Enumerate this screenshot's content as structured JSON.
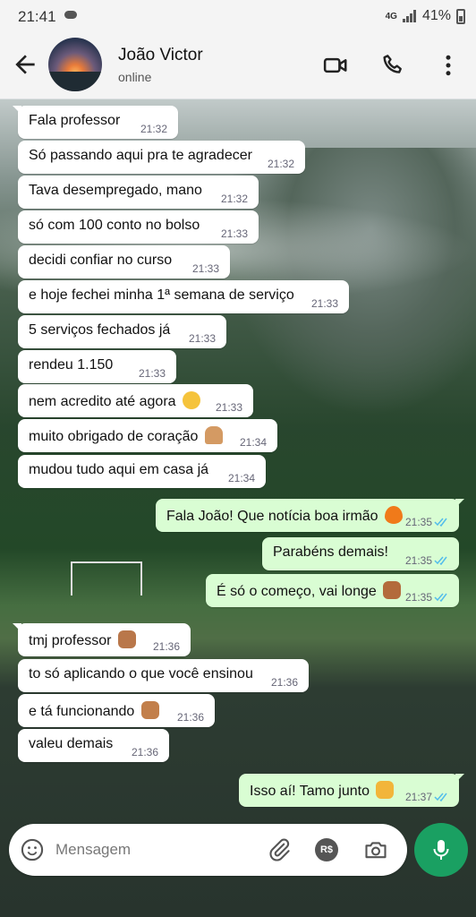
{
  "status_bar": {
    "time": "21:41",
    "network": "4G",
    "battery": "41%"
  },
  "header": {
    "contact_name": "João Victor",
    "contact_status": "online"
  },
  "messages": [
    {
      "dir": "in",
      "text": "Fala professor",
      "time": "21:32"
    },
    {
      "dir": "in",
      "text": "Só passando aqui pra te agradecer",
      "time": "21:32"
    },
    {
      "dir": "in",
      "text": "Tava desempregado, mano",
      "time": "21:32"
    },
    {
      "dir": "in",
      "text": "só com 100 conto no bolso",
      "time": "21:33"
    },
    {
      "dir": "in",
      "text": "decidi confiar no curso",
      "time": "21:33"
    },
    {
      "dir": "in",
      "text": "e hoje fechei minha 1ª semana de serviço",
      "time": "21:33"
    },
    {
      "dir": "in",
      "text": "5 serviços fechados já",
      "time": "21:33"
    },
    {
      "dir": "in",
      "text": "rendeu 1.150",
      "time": "21:33"
    },
    {
      "dir": "in",
      "text": "nem acredito até agora",
      "emoji": "laughing-tears-emoji",
      "time": "21:33"
    },
    {
      "dir": "in",
      "text": "muito obrigado de coração",
      "emoji": "praying-hands-emoji",
      "time": "21:34"
    },
    {
      "dir": "in",
      "text": "mudou tudo aqui em casa já",
      "time": "21:34"
    },
    {
      "dir": "out",
      "text": "Fala João! Que notícia boa irmão",
      "emoji": "fire-emoji",
      "time": "21:35"
    },
    {
      "dir": "out",
      "text": "Parabéns demais!",
      "time": "21:35"
    },
    {
      "dir": "out",
      "text": "É só o começo, vai longe",
      "emoji": "flexed-biceps-emoji",
      "time": "21:35"
    },
    {
      "dir": "in",
      "text": "tmj professor",
      "emoji": "fist-emoji",
      "time": "21:36"
    },
    {
      "dir": "in",
      "text": "to só aplicando o que você ensinou",
      "time": "21:36"
    },
    {
      "dir": "in",
      "text": "e tá funcionando",
      "emoji": "raising-hands-emoji",
      "time": "21:36"
    },
    {
      "dir": "in",
      "text": "valeu demais",
      "time": "21:36"
    },
    {
      "dir": "out",
      "text": "Isso aí! Tamo junto",
      "emoji": "handshake-emoji",
      "time": "21:37"
    }
  ],
  "composer": {
    "placeholder": "Mensagem",
    "payment_label": "R$"
  },
  "colors": {
    "incoming": "#ffffff",
    "outgoing": "#d9fdd3",
    "read_ticks": "#53bdeb",
    "accent": "#1aa062"
  }
}
